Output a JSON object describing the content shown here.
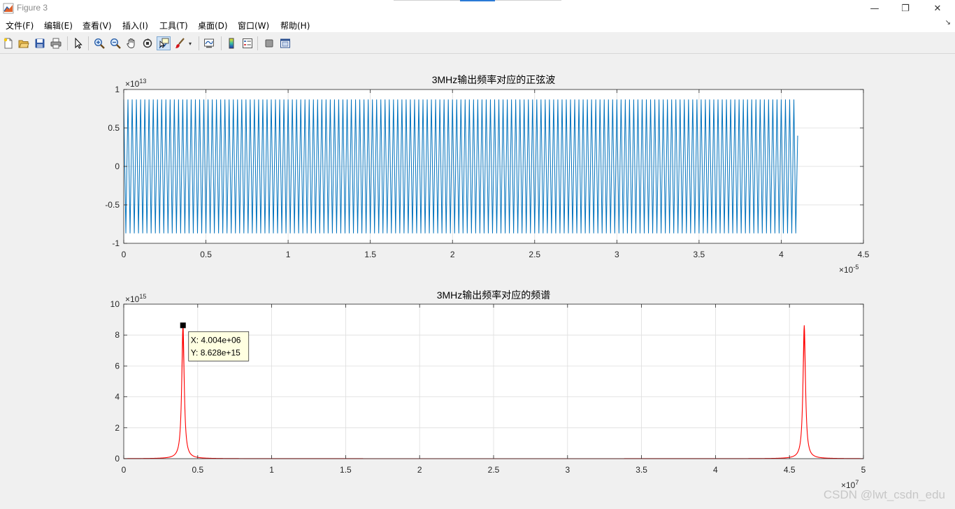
{
  "window": {
    "title": "Figure 3",
    "minimize_glyph": "—",
    "maximize_glyph": "❐",
    "close_glyph": "✕"
  },
  "menu": {
    "items": [
      "文件(F)",
      "编辑(E)",
      "查看(V)",
      "插入(I)",
      "工具(T)",
      "桌面(D)",
      "窗口(W)",
      "帮助(H)"
    ],
    "overflow_glyph": "↘"
  },
  "toolbar": {
    "icons": [
      "new-figure-icon",
      "open-file-icon",
      "save-icon",
      "print-icon",
      "select-arrow-icon",
      "zoom-in-icon",
      "zoom-out-icon",
      "pan-hand-icon",
      "rotate-3d-icon",
      "data-cursor-icon",
      "brush-icon",
      "link-plot-icon",
      "colorbar-icon",
      "legend-icon",
      "hide-plot-tools-icon",
      "show-plot-tools-icon"
    ],
    "active": "data-cursor-icon"
  },
  "colors": {
    "wave": "#0072bd",
    "spectrum": "#ff0000",
    "grid": "#dedede"
  },
  "chart_data": [
    {
      "type": "line",
      "title": "3MHz输出频率对应的正弦波",
      "x_exponent_label": "×10",
      "x_exponent": "-5",
      "y_exponent_label": "×10",
      "y_exponent": "13",
      "xticks": [
        "0",
        "0.5",
        "1",
        "1.5",
        "2",
        "2.5",
        "3",
        "3.5",
        "4",
        "4.5"
      ],
      "yticks": [
        "-1",
        "-0.5",
        "0",
        "0.5",
        "1"
      ],
      "xlim": [
        0,
        4.5e-05
      ],
      "ylim": [
        -10000000000000.0,
        10000000000000.0
      ],
      "grid": true,
      "series": [
        {
          "frequency_hz": 3900000.0,
          "amplitude": 8700000000000.0,
          "x_end": 4.1e-05,
          "last_value": 4000000000000.0
        }
      ]
    },
    {
      "type": "line",
      "title": "3MHz输出频率对应的频谱",
      "x_exponent_label": "×10",
      "x_exponent": "7",
      "y_exponent_label": "×10",
      "y_exponent": "15",
      "xticks": [
        "0",
        "0.5",
        "1",
        "1.5",
        "2",
        "2.5",
        "3",
        "3.5",
        "4",
        "4.5",
        "5"
      ],
      "yticks": [
        "0",
        "2",
        "4",
        "6",
        "8",
        "10"
      ],
      "xlim": [
        0,
        50000000.0
      ],
      "ylim": [
        0,
        1e+16
      ],
      "grid": true,
      "series": [
        {
          "peaks": [
            {
              "x": 4004000.0,
              "y": 8628000000000000.0
            },
            {
              "x": 46000000.0,
              "y": 8628000000000000.0
            }
          ]
        }
      ],
      "datatip": {
        "x": 4004000.0,
        "y": 8628000000000000.0,
        "x_text": "X: 4.004e+06",
        "y_text": "Y: 8.628e+15"
      }
    }
  ],
  "watermark": "CSDN @lwt_csdn_edu"
}
